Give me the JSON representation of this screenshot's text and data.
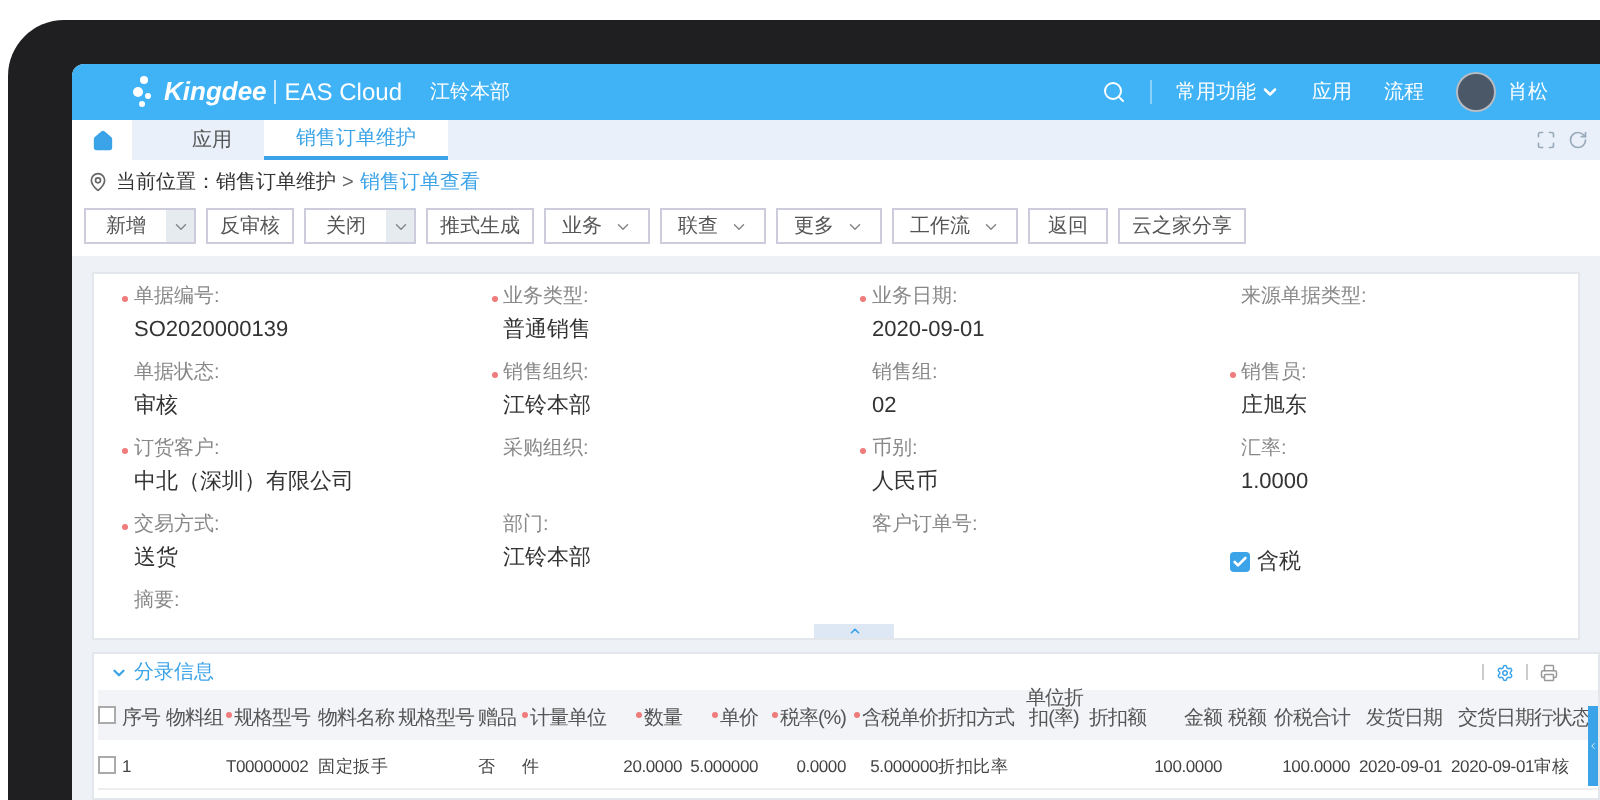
{
  "header": {
    "logo_text": "Kingdee",
    "product": "EAS Cloud",
    "org": "江铃本部",
    "menu": [
      {
        "label": "常用功能",
        "kind": "dropdown"
      },
      {
        "label": "应用",
        "kind": "link"
      },
      {
        "label": "流程",
        "kind": "link"
      }
    ],
    "user": "肖松"
  },
  "tabs": [
    {
      "label": "应用",
      "selected": false
    },
    {
      "label": "销售订单维护",
      "selected": true
    }
  ],
  "breadcrumb": {
    "prefix": "当前位置：",
    "items": [
      {
        "label": "销售订单维护",
        "current": false
      },
      {
        "label": "销售订单查看",
        "current": true
      }
    ],
    "separator": ">"
  },
  "toolbar": [
    {
      "label": "新增",
      "kind": "split"
    },
    {
      "label": "反审核",
      "kind": "plain"
    },
    {
      "label": "关闭",
      "kind": "split"
    },
    {
      "label": "推式生成",
      "kind": "plain"
    },
    {
      "label": "业务",
      "kind": "dropdown"
    },
    {
      "label": "联查",
      "kind": "dropdown"
    },
    {
      "label": "更多",
      "kind": "dropdown"
    },
    {
      "label": "工作流",
      "kind": "dropdown"
    },
    {
      "label": "返回",
      "kind": "plain"
    },
    {
      "label": "云之家分享",
      "kind": "plain"
    }
  ],
  "form": {
    "fields": [
      {
        "label": "单据编号:",
        "value": "SO2020000139",
        "required": true,
        "kind": "text"
      },
      {
        "label": "业务类型:",
        "value": "普通销售",
        "required": true,
        "kind": "text"
      },
      {
        "label": "业务日期:",
        "value": "2020-09-01",
        "required": true,
        "kind": "text"
      },
      {
        "label": "来源单据类型:",
        "required": false,
        "kind": "text"
      },
      {
        "label": "单据状态:",
        "value": "审核",
        "required": false,
        "kind": "text"
      },
      {
        "label": "销售组织:",
        "value": "江铃本部",
        "required": true,
        "kind": "text"
      },
      {
        "label": "销售组:",
        "value": "02",
        "required": false,
        "kind": "text"
      },
      {
        "label": "销售员:",
        "value": "庄旭东",
        "required": true,
        "kind": "text"
      },
      {
        "label": "订货客户:",
        "value": "中北（深圳）有限公司",
        "required": true,
        "kind": "text"
      },
      {
        "label": "采购组织:",
        "required": false,
        "kind": "text"
      },
      {
        "label": "币别:",
        "value": "人民币",
        "required": true,
        "kind": "text"
      },
      {
        "label": "汇率:",
        "value": "1.0000",
        "required": false,
        "kind": "text"
      },
      {
        "label": "交易方式:",
        "value": "送货",
        "required": true,
        "kind": "text"
      },
      {
        "label": "部门:",
        "value": "江铃本部",
        "required": false,
        "kind": "text"
      },
      {
        "label": "客户订单号:",
        "required": false,
        "kind": "text"
      },
      {
        "label": "含税",
        "checked": true,
        "kind": "checkbox"
      },
      {
        "label": "摘要:",
        "required": false,
        "kind": "text"
      }
    ]
  },
  "detail": {
    "title": "分录信息",
    "expanded": true,
    "table": {
      "all_checked": false,
      "columns": [
        {
          "label": "序号",
          "required": false
        },
        {
          "label": "物料组",
          "required": false
        },
        {
          "label": "规格型号",
          "required": true
        },
        {
          "label": "物料名称",
          "required": false
        },
        {
          "label": "规格型号",
          "required": false
        },
        {
          "label": "赠品",
          "required": false
        },
        {
          "label": "计量单位",
          "required": true
        },
        {
          "label": "数量",
          "required": true
        },
        {
          "label": "单价",
          "required": true
        },
        {
          "label": "税率(%)",
          "required": true
        },
        {
          "label": "含税单价",
          "required": true
        },
        {
          "label": "折扣方式",
          "required": false
        },
        {
          "label": "单位折扣(率)",
          "required": false
        },
        {
          "label": "折扣额",
          "required": false
        },
        {
          "label": "金额",
          "required": false
        },
        {
          "label": "税额",
          "required": false
        },
        {
          "label": "价税合计",
          "required": false
        },
        {
          "label": "发货日期",
          "required": false
        },
        {
          "label": "交货日期",
          "required": false
        },
        {
          "label": "行状态",
          "required": false
        }
      ],
      "rows": [
        {
          "checked": false,
          "cells": [
            "1",
            "",
            "T00000002",
            "固定扳手",
            "",
            "否",
            "件",
            "20.0000",
            "5.000000",
            "0.0000",
            "5.000000",
            "折扣比率",
            "",
            "",
            "100.0000",
            "",
            "100.0000",
            "2020-09-01",
            "2020-09-01",
            "审核"
          ]
        }
      ]
    }
  }
}
